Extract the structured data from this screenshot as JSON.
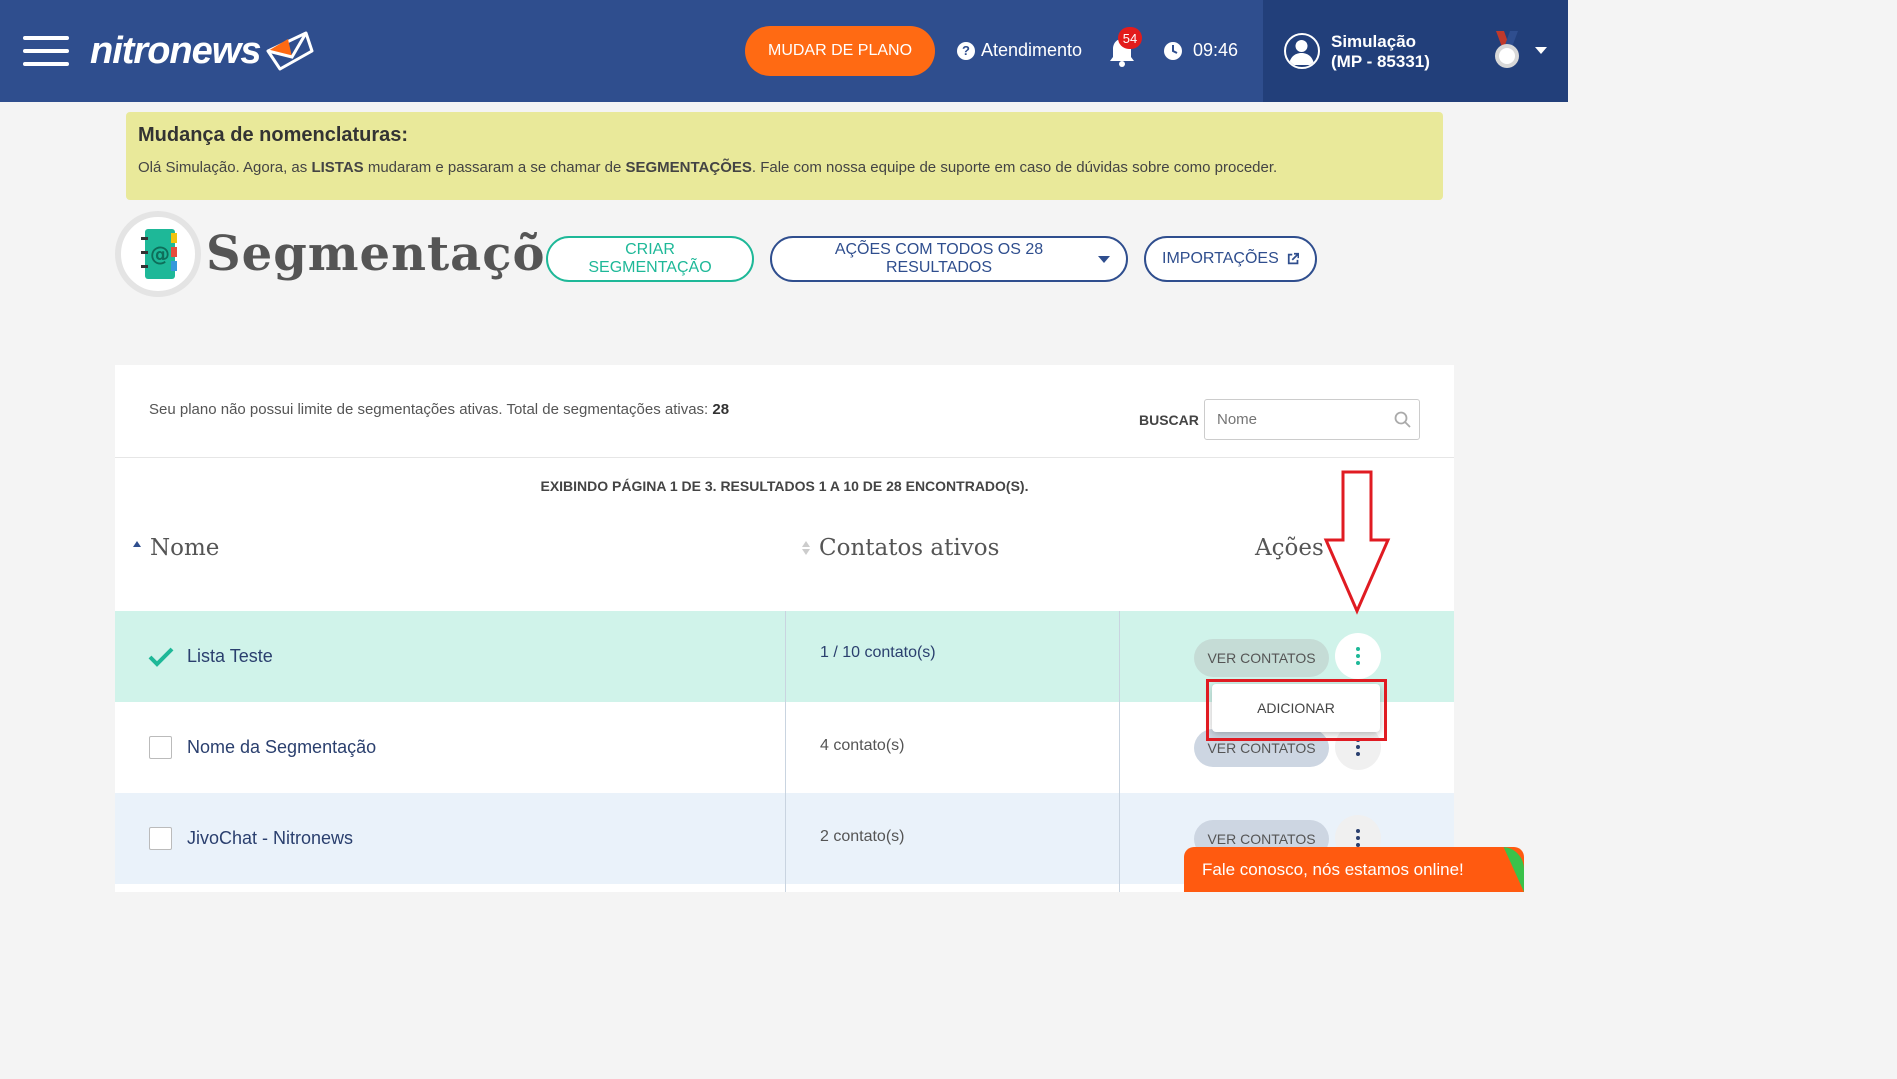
{
  "header": {
    "logo_text": "nitronews",
    "plan_button": "MUDAR DE PLANO",
    "help_label": "Atendimento",
    "notification_count": "54",
    "time": "09:46",
    "user_name": "Simulação",
    "user_id": "(MP - 85331)"
  },
  "notice": {
    "title": "Mudança de nomenclaturas:",
    "text_1": "Olá Simulação. Agora, as ",
    "bold_1": "LISTAS",
    "text_2": " mudaram e passaram a se chamar de ",
    "bold_2": "SEGMENTAÇÕES",
    "text_3": ". Fale com nossa equipe de suporte em caso de dúvidas sobre como proceder."
  },
  "page": {
    "title": "Segmentações",
    "create_button": "CRIAR SEGMENTAÇÃO",
    "actions_button": "AÇÕES COM TODOS OS 28 RESULTADOS",
    "imports_button": "IMPORTAÇÕES"
  },
  "card": {
    "plan_info": "Seu plano não possui limite de segmentações ativas. Total de segmentações ativas: ",
    "active_total": "28",
    "search_label": "BUSCAR",
    "search_placeholder": "Nome",
    "pagination": "EXIBINDO PÁGINA 1 DE 3. RESULTADOS 1 A 10 DE 28 ENCONTRADO(S)."
  },
  "table": {
    "headers": {
      "name": "Nome",
      "contacts": "Contatos ativos",
      "actions": "Ações"
    },
    "rows": [
      {
        "name": "Lista Teste",
        "contacts": "1 / 10 contato(s)",
        "view": "VER CONTATOS",
        "checked": true
      },
      {
        "name": "Nome da Segmentação",
        "contacts": "4 contato(s)",
        "view": "VER CONTATOS",
        "checked": false
      },
      {
        "name": "JivoChat - Nitronews",
        "contacts": "2 contato(s)",
        "view": "VER CONTATOS",
        "checked": false
      }
    ]
  },
  "dropdown": {
    "add": "ADICIONAR"
  },
  "chat": {
    "label": "Fale conosco, nós estamos online!"
  },
  "colors": {
    "header_bg": "#2f4e8e",
    "accent_orange": "#ff6a13",
    "accent_green": "#1eb898",
    "selected_row": "#d0f3ea",
    "highlight_red": "#e01b22"
  }
}
